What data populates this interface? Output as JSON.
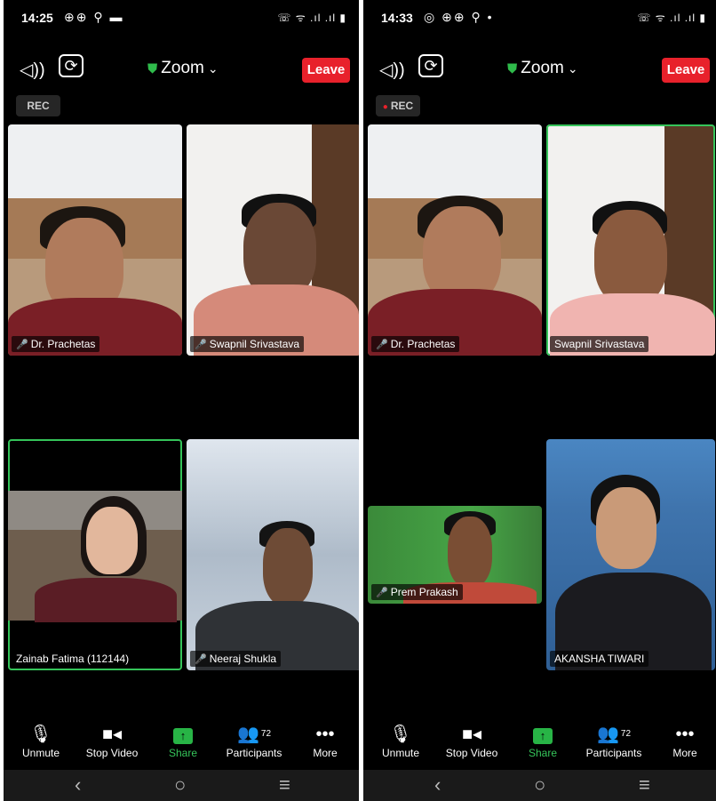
{
  "left": {
    "status": {
      "time": "14:25",
      "icons_left": "⊕⊕ ⚲ ▬",
      "icons_right": "☏ ᯤ .ıl .ıl ▮"
    },
    "header": {
      "title": "Zoom",
      "leave_label": "Leave",
      "rec_label": "REC"
    },
    "tiles": [
      {
        "name": "Dr. Prachetas"
      },
      {
        "name": "Swapnil Srivastava"
      },
      {
        "name": "Zainab Fatima (112144)"
      },
      {
        "name": "Neeraj Shukla"
      }
    ]
  },
  "right": {
    "status": {
      "time": "14:33",
      "icons_left": "◎ ⊕⊕ ⚲ •",
      "icons_right": "☏ ᯤ .ıl .ıl ▮"
    },
    "header": {
      "title": "Zoom",
      "leave_label": "Leave",
      "rec_label": "REC"
    },
    "tiles": [
      {
        "name": "Dr. Prachetas"
      },
      {
        "name": "Swapnil Srivastava"
      },
      {
        "name": "Prem Prakash"
      },
      {
        "name": "AKANSHA TIWARI"
      }
    ]
  },
  "toolbar": {
    "unmute": "Unmute",
    "stop_video": "Stop Video",
    "share": "Share",
    "participants": "Participants",
    "participants_count": "72",
    "more": "More"
  },
  "colors": {
    "leave": "#e8212b",
    "accent_green": "#35c45a",
    "shield": "#2fbb4b"
  }
}
